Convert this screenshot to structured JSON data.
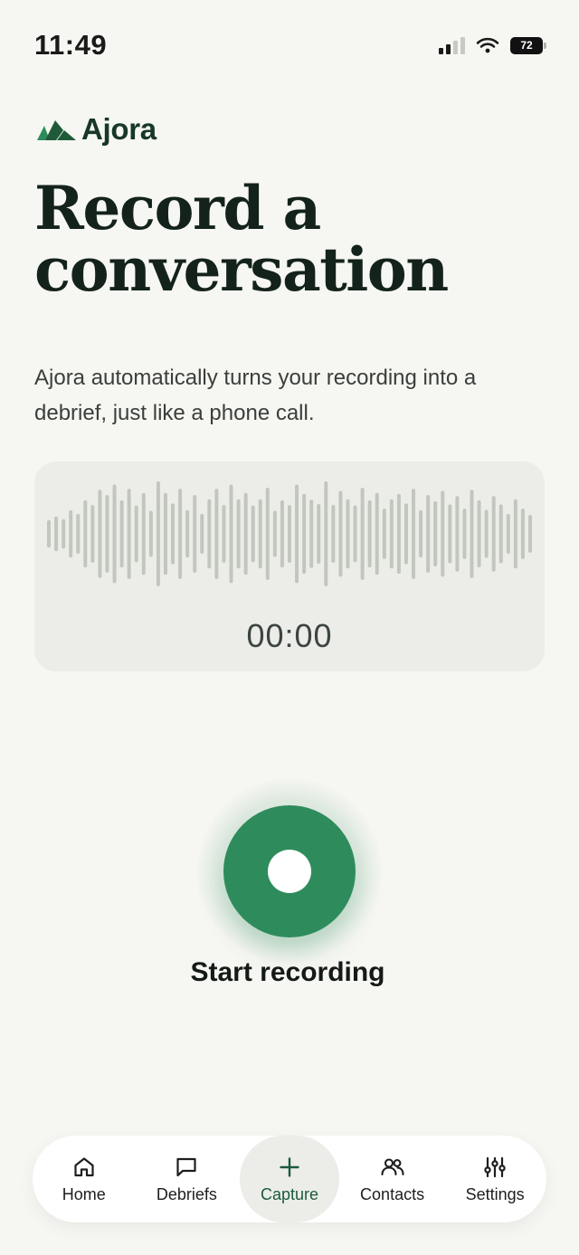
{
  "status_bar": {
    "time": "11:49",
    "battery": "72"
  },
  "brand": {
    "name": "Ajora",
    "color": "#1f5a3a"
  },
  "title": "Record a conversation",
  "description": "Ajora automatically turns your recording into a debrief, just like a phone call.",
  "recorder": {
    "timer": "00:00",
    "start_label": "Start recording",
    "accent": "#2e8c5c",
    "waveform_levels": [
      0.26,
      0.33,
      0.28,
      0.45,
      0.38,
      0.64,
      0.55,
      0.84,
      0.74,
      0.94,
      0.64,
      0.86,
      0.54,
      0.78,
      0.44,
      1.0,
      0.78,
      0.58,
      0.86,
      0.45,
      0.74,
      0.38,
      0.66,
      0.86,
      0.55,
      0.94,
      0.66,
      0.78,
      0.54,
      0.66,
      0.88,
      0.44,
      0.64,
      0.55,
      0.94,
      0.76,
      0.65,
      0.57,
      1.0,
      0.55,
      0.82,
      0.66,
      0.54,
      0.88,
      0.64,
      0.78,
      0.48,
      0.66,
      0.76,
      0.58,
      0.86,
      0.45,
      0.74,
      0.62,
      0.82,
      0.56,
      0.72,
      0.48,
      0.84,
      0.64,
      0.46,
      0.72,
      0.56,
      0.38,
      0.66,
      0.48,
      0.36
    ]
  },
  "tabs": [
    {
      "label": "Home",
      "icon": "home-icon"
    },
    {
      "label": "Debriefs",
      "icon": "chat-bubble-icon"
    },
    {
      "label": "Capture",
      "icon": "plus-icon",
      "active": true
    },
    {
      "label": "Contacts",
      "icon": "people-icon"
    },
    {
      "label": "Settings",
      "icon": "sliders-icon"
    }
  ]
}
